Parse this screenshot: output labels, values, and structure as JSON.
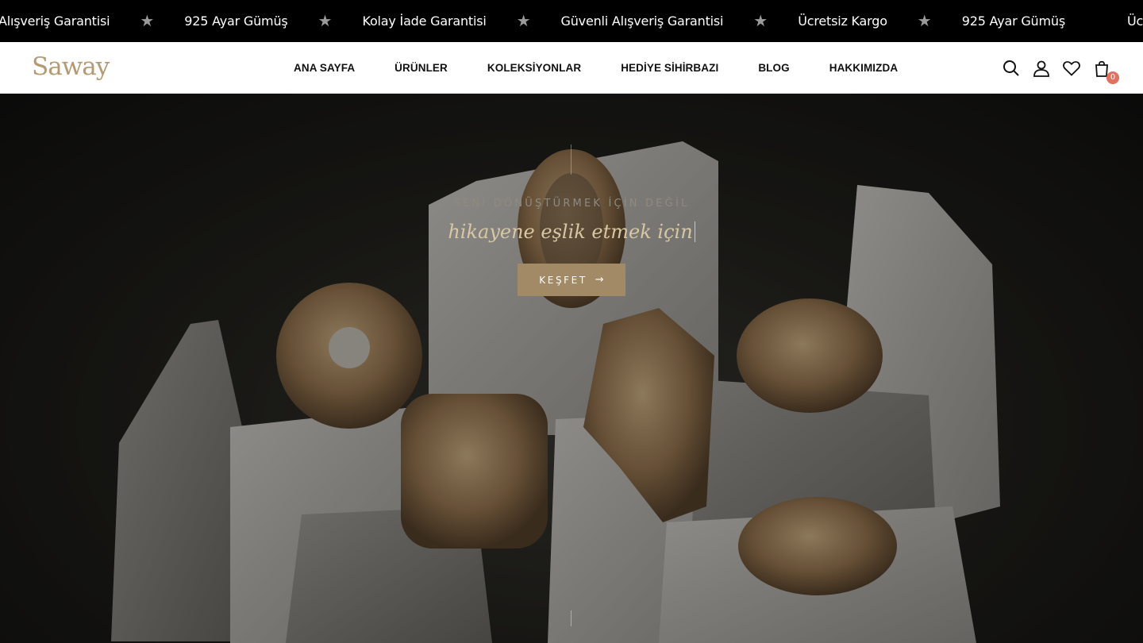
{
  "announcements": [
    "Alışveriş Garantisi",
    "925 Ayar Gümüş",
    "Kolay İade Garantisi",
    "Güvenli Alışveriş Garantisi",
    "Ücretsiz Kargo",
    "925 Ayar Gümüş",
    "Ücretsiz Kargo"
  ],
  "separator_glyph": "★",
  "brand": {
    "logo_text": "Saway",
    "logo_color": "#b39a72"
  },
  "nav": {
    "items": [
      "ANA SAYFA",
      "ÜRÜNLER",
      "KOLEKSİYONLAR",
      "HEDİYE SİHİRBAZI",
      "BLOG",
      "HAKKIMIZDA"
    ]
  },
  "header_icons": {
    "search": "search-icon",
    "account": "user-icon",
    "wishlist": "heart-icon",
    "cart": "shopping-bag-icon",
    "cart_count": "0",
    "badge_color": "#e36f5f"
  },
  "hero": {
    "kicker": "SENİ DÖNÜŞTÜRMEK İÇİN DEĞİL",
    "title": "hikayene eşlik etmek için",
    "button_label": "KEŞFET",
    "button_icon": "arrow-right-icon",
    "button_color": "#a18a65"
  }
}
